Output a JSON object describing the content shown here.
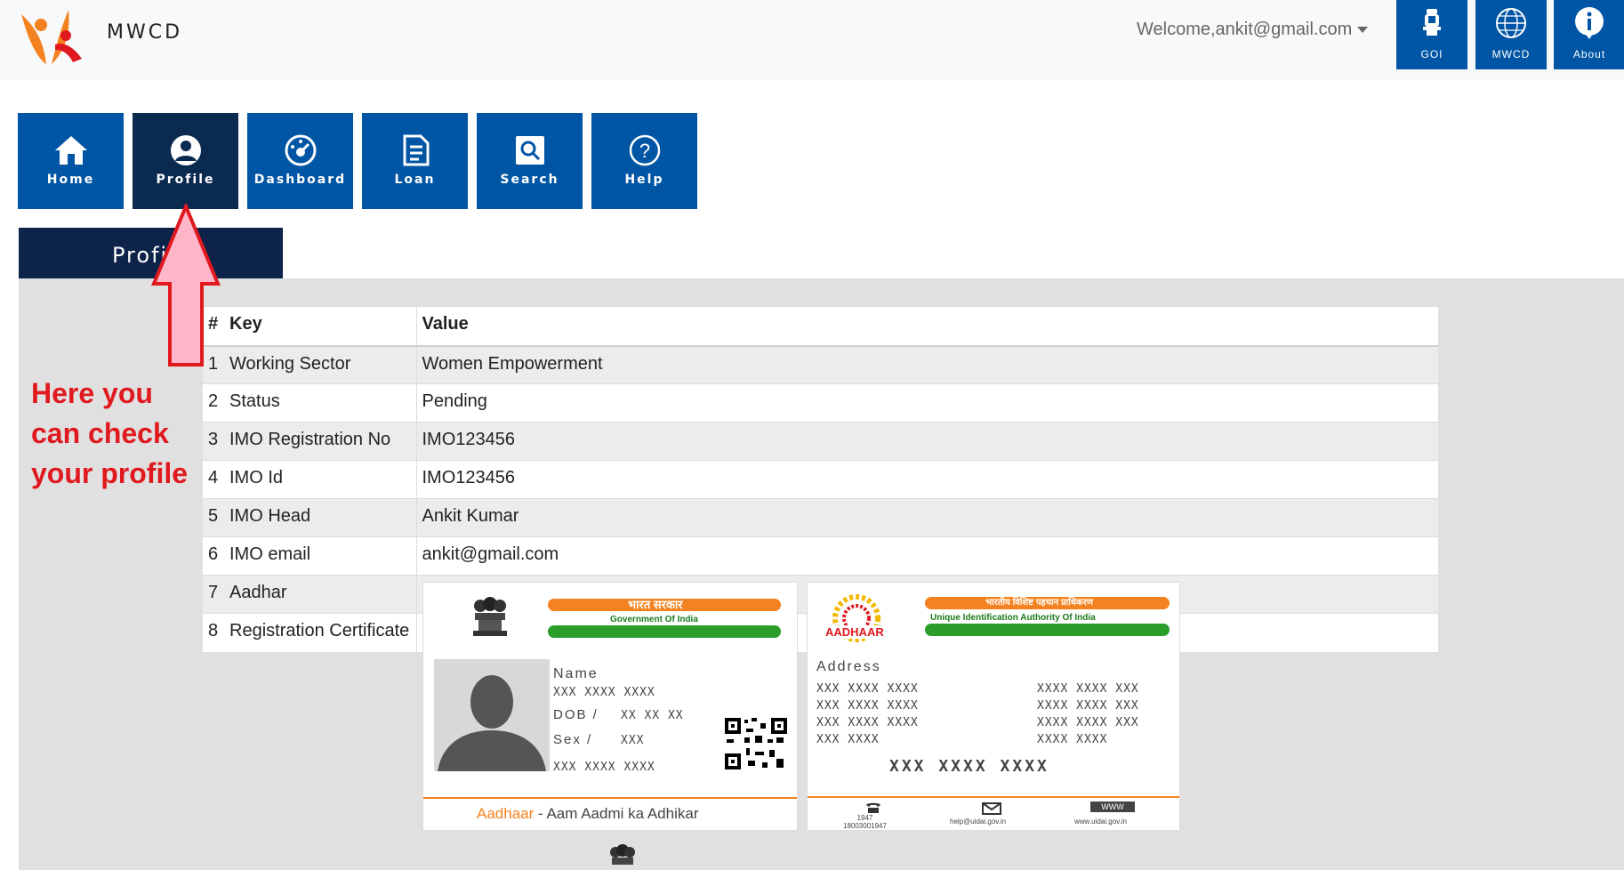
{
  "header": {
    "brand": "MWCD",
    "welcome": "Welcome,ankit@gmail.com",
    "buttons": [
      {
        "label": "GOI",
        "icon": "emblem-icon"
      },
      {
        "label": "MWCD",
        "icon": "globe-icon"
      },
      {
        "label": "About",
        "icon": "info-icon"
      }
    ]
  },
  "nav": [
    {
      "label": "Home",
      "icon": "home-icon"
    },
    {
      "label": "Profile",
      "icon": "user-icon",
      "active": true
    },
    {
      "label": "Dashboard",
      "icon": "dashboard-icon"
    },
    {
      "label": "Loan",
      "icon": "document-icon"
    },
    {
      "label": "Search",
      "icon": "search-icon"
    },
    {
      "label": "Help",
      "icon": "help-icon"
    }
  ],
  "section": {
    "title": "Profile"
  },
  "annotation": {
    "line1": "Here you",
    "line2": "can check",
    "line3": "your profile"
  },
  "table": {
    "headers": [
      "#",
      "Key",
      "Value"
    ],
    "rows": [
      {
        "n": "1",
        "key": "Working Sector",
        "value": "Women Empowerment"
      },
      {
        "n": "2",
        "key": "Status",
        "value": "Pending"
      },
      {
        "n": "3",
        "key": "IMO Registration No",
        "value": "IMO123456"
      },
      {
        "n": "4",
        "key": "IMO Id",
        "value": "IMO123456"
      },
      {
        "n": "5",
        "key": "IMO Head",
        "value": "Ankit Kumar"
      },
      {
        "n": "6",
        "key": "IMO email",
        "value": "ankit@gmail.com"
      },
      {
        "n": "7",
        "key": "Aadhar",
        "value": ""
      },
      {
        "n": "8",
        "key": "Registration Certificate",
        "value": ""
      }
    ]
  },
  "aadhar_card": {
    "front": {
      "gov_hindi": "भारत सरकार",
      "gov": "Government Of India",
      "name_label": "Name",
      "name_value": "XXX XXXX XXXX",
      "dob_label": "DOB /",
      "dob_value": "XX XX XX",
      "sex_label": "Sex /",
      "sex_value": "XXX",
      "number": "XXX XXXX XXXX",
      "footer_brand": "Aadhaar",
      "footer_tagline": " - Aam Aadmi ka Adhikar"
    },
    "back": {
      "logo_text": "AADHAAR",
      "uidai_hindi": "भारतीय विशिष्ट पहचान प्राधिकरण",
      "uidai": "Unique Identification Authority Of India",
      "address_label": "Address",
      "addr_left": [
        "XXX XXXX XXXX",
        "XXX XXXX XXXX",
        "XXX XXXX XXXX",
        "XXX XXXX"
      ],
      "addr_right": [
        "XXXX XXXX XXX",
        "XXXX XXXX XXX",
        "XXXX XXXX XXX",
        "XXXX XXXX"
      ],
      "number": "XXX XXXX XXXX",
      "phone": "1947\n18003001947",
      "email": "help@uidai.gov.in",
      "web": "www.uidai.gov.in",
      "web_badge": "WWW"
    }
  },
  "colors": {
    "primary": "#0055a5",
    "active": "#0a2a50",
    "annotation": "#e0191e",
    "arrow_fill": "#ffb6c8"
  }
}
